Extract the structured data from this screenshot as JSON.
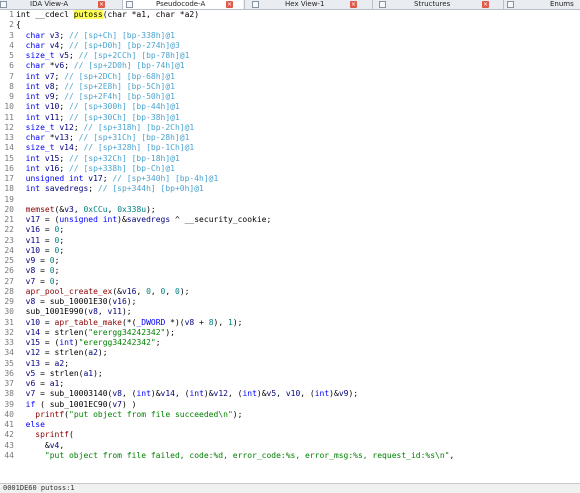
{
  "tabs": [
    {
      "label": "IDA View-A",
      "icon": "ida-view-icon"
    },
    {
      "label": "Pseudocode-A",
      "icon": "pseudocode-icon"
    },
    {
      "label": "Hex View-1",
      "icon": "hex-view-icon"
    },
    {
      "label": "Structures",
      "icon": "structures-icon"
    },
    {
      "label": "Enums",
      "icon": "enums-icon"
    }
  ],
  "close_glyph": "×",
  "status_text": "0001DE60 putoss:1",
  "code_lines": [
    [
      [
        "pl",
        "int __cdecl "
      ],
      [
        "hl",
        "putoss"
      ],
      [
        "pl",
        "(char *a1, char *a2)"
      ]
    ],
    [
      [
        "pl",
        "{"
      ]
    ],
    [
      [
        "kw",
        "  char "
      ],
      [
        "v",
        "v3"
      ],
      [
        "pl",
        "; "
      ],
      [
        "cm",
        "// [sp+Ch] [bp-338h]@1"
      ]
    ],
    [
      [
        "kw",
        "  char "
      ],
      [
        "v",
        "v4"
      ],
      [
        "pl",
        "; "
      ],
      [
        "cm",
        "// [sp+D0h] [bp-274h]@3"
      ]
    ],
    [
      [
        "kw",
        "  size_t "
      ],
      [
        "v",
        "v5"
      ],
      [
        "pl",
        "; "
      ],
      [
        "cm",
        "// [sp+2CCh] [bp-78h]@1"
      ]
    ],
    [
      [
        "kw",
        "  char "
      ],
      [
        "pl",
        "*"
      ],
      [
        "v",
        "v6"
      ],
      [
        "pl",
        "; "
      ],
      [
        "cm",
        "// [sp+2D0h] [bp-74h]@1"
      ]
    ],
    [
      [
        "kw",
        "  int "
      ],
      [
        "v",
        "v7"
      ],
      [
        "pl",
        "; "
      ],
      [
        "cm",
        "// [sp+2DCh] [bp-68h]@1"
      ]
    ],
    [
      [
        "kw",
        "  int "
      ],
      [
        "v",
        "v8"
      ],
      [
        "pl",
        "; "
      ],
      [
        "cm",
        "// [sp+2E8h] [bp-5Ch]@1"
      ]
    ],
    [
      [
        "kw",
        "  int "
      ],
      [
        "v",
        "v9"
      ],
      [
        "pl",
        "; "
      ],
      [
        "cm",
        "// [sp+2F4h] [bp-50h]@1"
      ]
    ],
    [
      [
        "kw",
        "  int "
      ],
      [
        "v",
        "v10"
      ],
      [
        "pl",
        "; "
      ],
      [
        "cm",
        "// [sp+300h] [bp-44h]@1"
      ]
    ],
    [
      [
        "kw",
        "  int "
      ],
      [
        "v",
        "v11"
      ],
      [
        "pl",
        "; "
      ],
      [
        "cm",
        "// [sp+30Ch] [bp-38h]@1"
      ]
    ],
    [
      [
        "kw",
        "  size_t "
      ],
      [
        "v",
        "v12"
      ],
      [
        "pl",
        "; "
      ],
      [
        "cm",
        "// [sp+318h] [bp-2Ch]@1"
      ]
    ],
    [
      [
        "kw",
        "  char "
      ],
      [
        "pl",
        "*"
      ],
      [
        "v",
        "v13"
      ],
      [
        "pl",
        "; "
      ],
      [
        "cm",
        "// [sp+31Ch] [bp-28h]@1"
      ]
    ],
    [
      [
        "kw",
        "  size_t "
      ],
      [
        "v",
        "v14"
      ],
      [
        "pl",
        "; "
      ],
      [
        "cm",
        "// [sp+328h] [bp-1Ch]@1"
      ]
    ],
    [
      [
        "kw",
        "  int "
      ],
      [
        "v",
        "v15"
      ],
      [
        "pl",
        "; "
      ],
      [
        "cm",
        "// [sp+32Ch] [bp-18h]@1"
      ]
    ],
    [
      [
        "kw",
        "  int "
      ],
      [
        "v",
        "v16"
      ],
      [
        "pl",
        "; "
      ],
      [
        "cm",
        "// [sp+338h] [bp-Ch]@1"
      ]
    ],
    [
      [
        "kw",
        "  unsigned int "
      ],
      [
        "v",
        "v17"
      ],
      [
        "pl",
        "; "
      ],
      [
        "cm",
        "// [sp+340h] [bp-4h]@1"
      ]
    ],
    [
      [
        "kw",
        "  int "
      ],
      [
        "v",
        "savedregs"
      ],
      [
        "pl",
        "; "
      ],
      [
        "cm",
        "// [sp+344h] [bp+0h]@1"
      ]
    ],
    [
      [
        "pl",
        ""
      ]
    ],
    [
      [
        "pl",
        "  "
      ],
      [
        "fn",
        "memset"
      ],
      [
        "pl",
        "(&"
      ],
      [
        "v",
        "v3"
      ],
      [
        "pl",
        ", "
      ],
      [
        "num",
        "0xCCu"
      ],
      [
        "pl",
        ", "
      ],
      [
        "num",
        "0x338u"
      ],
      [
        "pl",
        ");"
      ]
    ],
    [
      [
        "pl",
        "  "
      ],
      [
        "v",
        "v17"
      ],
      [
        "pl",
        " = ("
      ],
      [
        "kw",
        "unsigned int"
      ],
      [
        "pl",
        ")&"
      ],
      [
        "v",
        "savedregs"
      ],
      [
        "pl",
        " ^ __security_cookie;"
      ]
    ],
    [
      [
        "pl",
        "  "
      ],
      [
        "v",
        "v16"
      ],
      [
        "pl",
        " = "
      ],
      [
        "num",
        "0"
      ],
      [
        "pl",
        ";"
      ]
    ],
    [
      [
        "pl",
        "  "
      ],
      [
        "v",
        "v11"
      ],
      [
        "pl",
        " = "
      ],
      [
        "num",
        "0"
      ],
      [
        "pl",
        ";"
      ]
    ],
    [
      [
        "pl",
        "  "
      ],
      [
        "v",
        "v10"
      ],
      [
        "pl",
        " = "
      ],
      [
        "num",
        "0"
      ],
      [
        "pl",
        ";"
      ]
    ],
    [
      [
        "pl",
        "  "
      ],
      [
        "v",
        "v9"
      ],
      [
        "pl",
        " = "
      ],
      [
        "num",
        "0"
      ],
      [
        "pl",
        ";"
      ]
    ],
    [
      [
        "pl",
        "  "
      ],
      [
        "v",
        "v8"
      ],
      [
        "pl",
        " = "
      ],
      [
        "num",
        "0"
      ],
      [
        "pl",
        ";"
      ]
    ],
    [
      [
        "pl",
        "  "
      ],
      [
        "v",
        "v7"
      ],
      [
        "pl",
        " = "
      ],
      [
        "num",
        "0"
      ],
      [
        "pl",
        ";"
      ]
    ],
    [
      [
        "pl",
        "  "
      ],
      [
        "fn",
        "apr_pool_create_ex"
      ],
      [
        "pl",
        "(&"
      ],
      [
        "v",
        "v16"
      ],
      [
        "pl",
        ", "
      ],
      [
        "num",
        "0"
      ],
      [
        "pl",
        ", "
      ],
      [
        "num",
        "0"
      ],
      [
        "pl",
        ", "
      ],
      [
        "num",
        "0"
      ],
      [
        "pl",
        ");"
      ]
    ],
    [
      [
        "pl",
        "  "
      ],
      [
        "v",
        "v8"
      ],
      [
        "pl",
        " = sub_10001E30("
      ],
      [
        "v",
        "v16"
      ],
      [
        "pl",
        ");"
      ]
    ],
    [
      [
        "pl",
        "  sub_1001E990("
      ],
      [
        "v",
        "v8"
      ],
      [
        "pl",
        ", "
      ],
      [
        "v",
        "v11"
      ],
      [
        "pl",
        ");"
      ]
    ],
    [
      [
        "pl",
        "  "
      ],
      [
        "v",
        "v10"
      ],
      [
        "pl",
        " = "
      ],
      [
        "fn",
        "apr_table_make"
      ],
      [
        "pl",
        "(*("
      ],
      [
        "kw",
        "_DWORD"
      ],
      [
        "pl",
        " *)("
      ],
      [
        "v",
        "v8"
      ],
      [
        "pl",
        " + "
      ],
      [
        "num",
        "8"
      ],
      [
        "pl",
        "), "
      ],
      [
        "num",
        "1"
      ],
      [
        "pl",
        ");"
      ]
    ],
    [
      [
        "pl",
        "  "
      ],
      [
        "v",
        "v14"
      ],
      [
        "pl",
        " = strlen("
      ],
      [
        "st",
        "\"erergg34242342\""
      ],
      [
        "pl",
        ");"
      ]
    ],
    [
      [
        "pl",
        "  "
      ],
      [
        "v",
        "v15"
      ],
      [
        "pl",
        " = ("
      ],
      [
        "kw",
        "int"
      ],
      [
        "pl",
        ")"
      ],
      [
        "st",
        "\"erergg34242342\""
      ],
      [
        "pl",
        ";"
      ]
    ],
    [
      [
        "pl",
        "  "
      ],
      [
        "v",
        "v12"
      ],
      [
        "pl",
        " = strlen("
      ],
      [
        "v",
        "a2"
      ],
      [
        "pl",
        ");"
      ]
    ],
    [
      [
        "pl",
        "  "
      ],
      [
        "v",
        "v13"
      ],
      [
        "pl",
        " = "
      ],
      [
        "v",
        "a2"
      ],
      [
        "pl",
        ";"
      ]
    ],
    [
      [
        "pl",
        "  "
      ],
      [
        "v",
        "v5"
      ],
      [
        "pl",
        " = strlen("
      ],
      [
        "v",
        "a1"
      ],
      [
        "pl",
        ");"
      ]
    ],
    [
      [
        "pl",
        "  "
      ],
      [
        "v",
        "v6"
      ],
      [
        "pl",
        " = "
      ],
      [
        "v",
        "a1"
      ],
      [
        "pl",
        ";"
      ]
    ],
    [
      [
        "pl",
        "  "
      ],
      [
        "v",
        "v7"
      ],
      [
        "pl",
        " = sub_10003140("
      ],
      [
        "v",
        "v8"
      ],
      [
        "pl",
        ", ("
      ],
      [
        "kw",
        "int"
      ],
      [
        "pl",
        ")&"
      ],
      [
        "v",
        "v14"
      ],
      [
        "pl",
        ", ("
      ],
      [
        "kw",
        "int"
      ],
      [
        "pl",
        ")&"
      ],
      [
        "v",
        "v12"
      ],
      [
        "pl",
        ", ("
      ],
      [
        "kw",
        "int"
      ],
      [
        "pl",
        ")&"
      ],
      [
        "v",
        "v5"
      ],
      [
        "pl",
        ", "
      ],
      [
        "v",
        "v10"
      ],
      [
        "pl",
        ", ("
      ],
      [
        "kw",
        "int"
      ],
      [
        "pl",
        ")&"
      ],
      [
        "v",
        "v9"
      ],
      [
        "pl",
        ");"
      ]
    ],
    [
      [
        "kw",
        "  if"
      ],
      [
        "pl",
        " ( sub_1001EC90("
      ],
      [
        "v",
        "v7"
      ],
      [
        "pl",
        ") )"
      ]
    ],
    [
      [
        "pl",
        "    "
      ],
      [
        "fn",
        "printf"
      ],
      [
        "pl",
        "("
      ],
      [
        "st",
        "\"put object from file succeeded\\n\""
      ],
      [
        "pl",
        ");"
      ]
    ],
    [
      [
        "kw",
        "  else"
      ]
    ],
    [
      [
        "pl",
        "    "
      ],
      [
        "fn",
        "sprintf"
      ],
      [
        "pl",
        "("
      ]
    ],
    [
      [
        "pl",
        "      &"
      ],
      [
        "v",
        "v4"
      ],
      [
        "pl",
        ","
      ]
    ],
    [
      [
        "pl",
        "      "
      ],
      [
        "st",
        "\"put object from file failed, code:%d, error_code:%s, error_msg:%s, request_id:%s\\n\""
      ],
      [
        "pl",
        ","
      ]
    ]
  ]
}
